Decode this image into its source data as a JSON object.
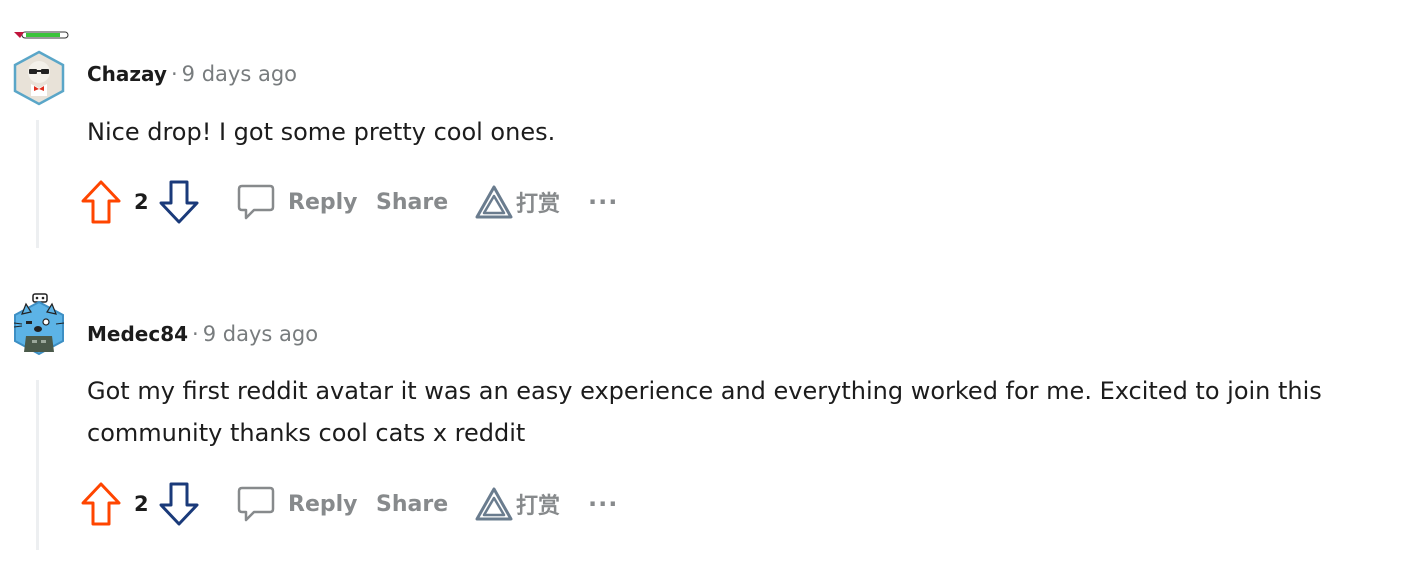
{
  "comments": [
    {
      "author": "Chazay",
      "separator": "·",
      "timestamp": "9 days ago",
      "text": "Nice drop! I got some pretty cool ones.",
      "votes": "2",
      "reply_label": "Reply",
      "share_label": "Share",
      "award_label": "打赏",
      "more_label": "···",
      "avatar_icon": "sunglasses-avatar-icon"
    },
    {
      "author": "Medec84",
      "separator": "·",
      "timestamp": "9 days ago",
      "text": "Got my first reddit avatar it was an easy experience and everything worked for me. Excited to join this community thanks cool cats x reddit",
      "votes": "2",
      "reply_label": "Reply",
      "share_label": "Share",
      "award_label": "打赏",
      "more_label": "···",
      "avatar_icon": "blue-cat-avatar-icon"
    }
  ],
  "colors": {
    "upvote": "#ff4500",
    "downvote": "#1a3a7a",
    "muted": "#878a8c",
    "thread_line": "#edeff1"
  }
}
